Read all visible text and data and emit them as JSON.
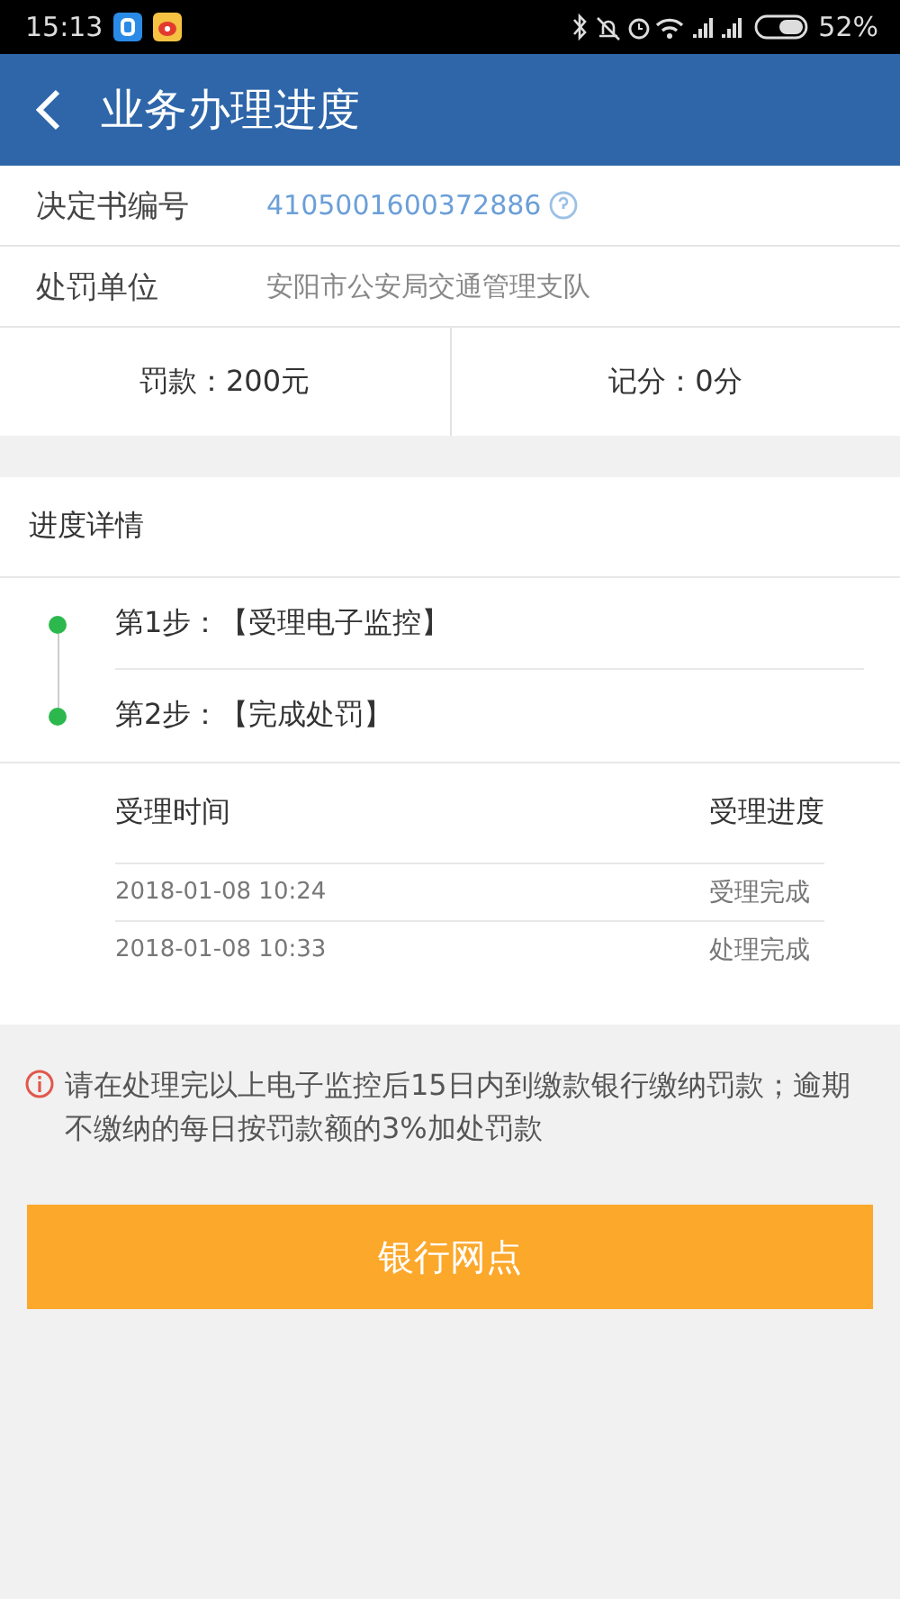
{
  "status_bar": {
    "time": "15:13",
    "battery": "52%"
  },
  "header": {
    "title": "业务办理进度"
  },
  "info_rows": [
    {
      "label": "决定书编号",
      "value": "4105001600372886",
      "kind": "link"
    },
    {
      "label": "处罚单位",
      "value": "安阳市公安局交通管理支队",
      "kind": "plain"
    }
  ],
  "summary": [
    {
      "text": "罚款：200元"
    },
    {
      "text": "记分：0分"
    }
  ],
  "progress": {
    "title": "进度详情",
    "steps": [
      {
        "prefix": "第1步：",
        "text": "【受理电子监控】",
        "color": "#2db84d"
      },
      {
        "prefix": "第2步：",
        "text": "【完成处罚】",
        "color": "#2db84d"
      }
    ],
    "table": {
      "columns": [
        "受理时间",
        "受理进度"
      ],
      "rows": [
        [
          "2018-01-08 10:24",
          "受理完成"
        ],
        [
          "2018-01-08 10:33",
          "处理完成"
        ]
      ]
    }
  },
  "notice": "请在处理完以上电子监控后15日内到缴款银行缴纳罚款；逾期不缴纳的每日按罚款额的3%加处罚款",
  "button": "银行网点"
}
